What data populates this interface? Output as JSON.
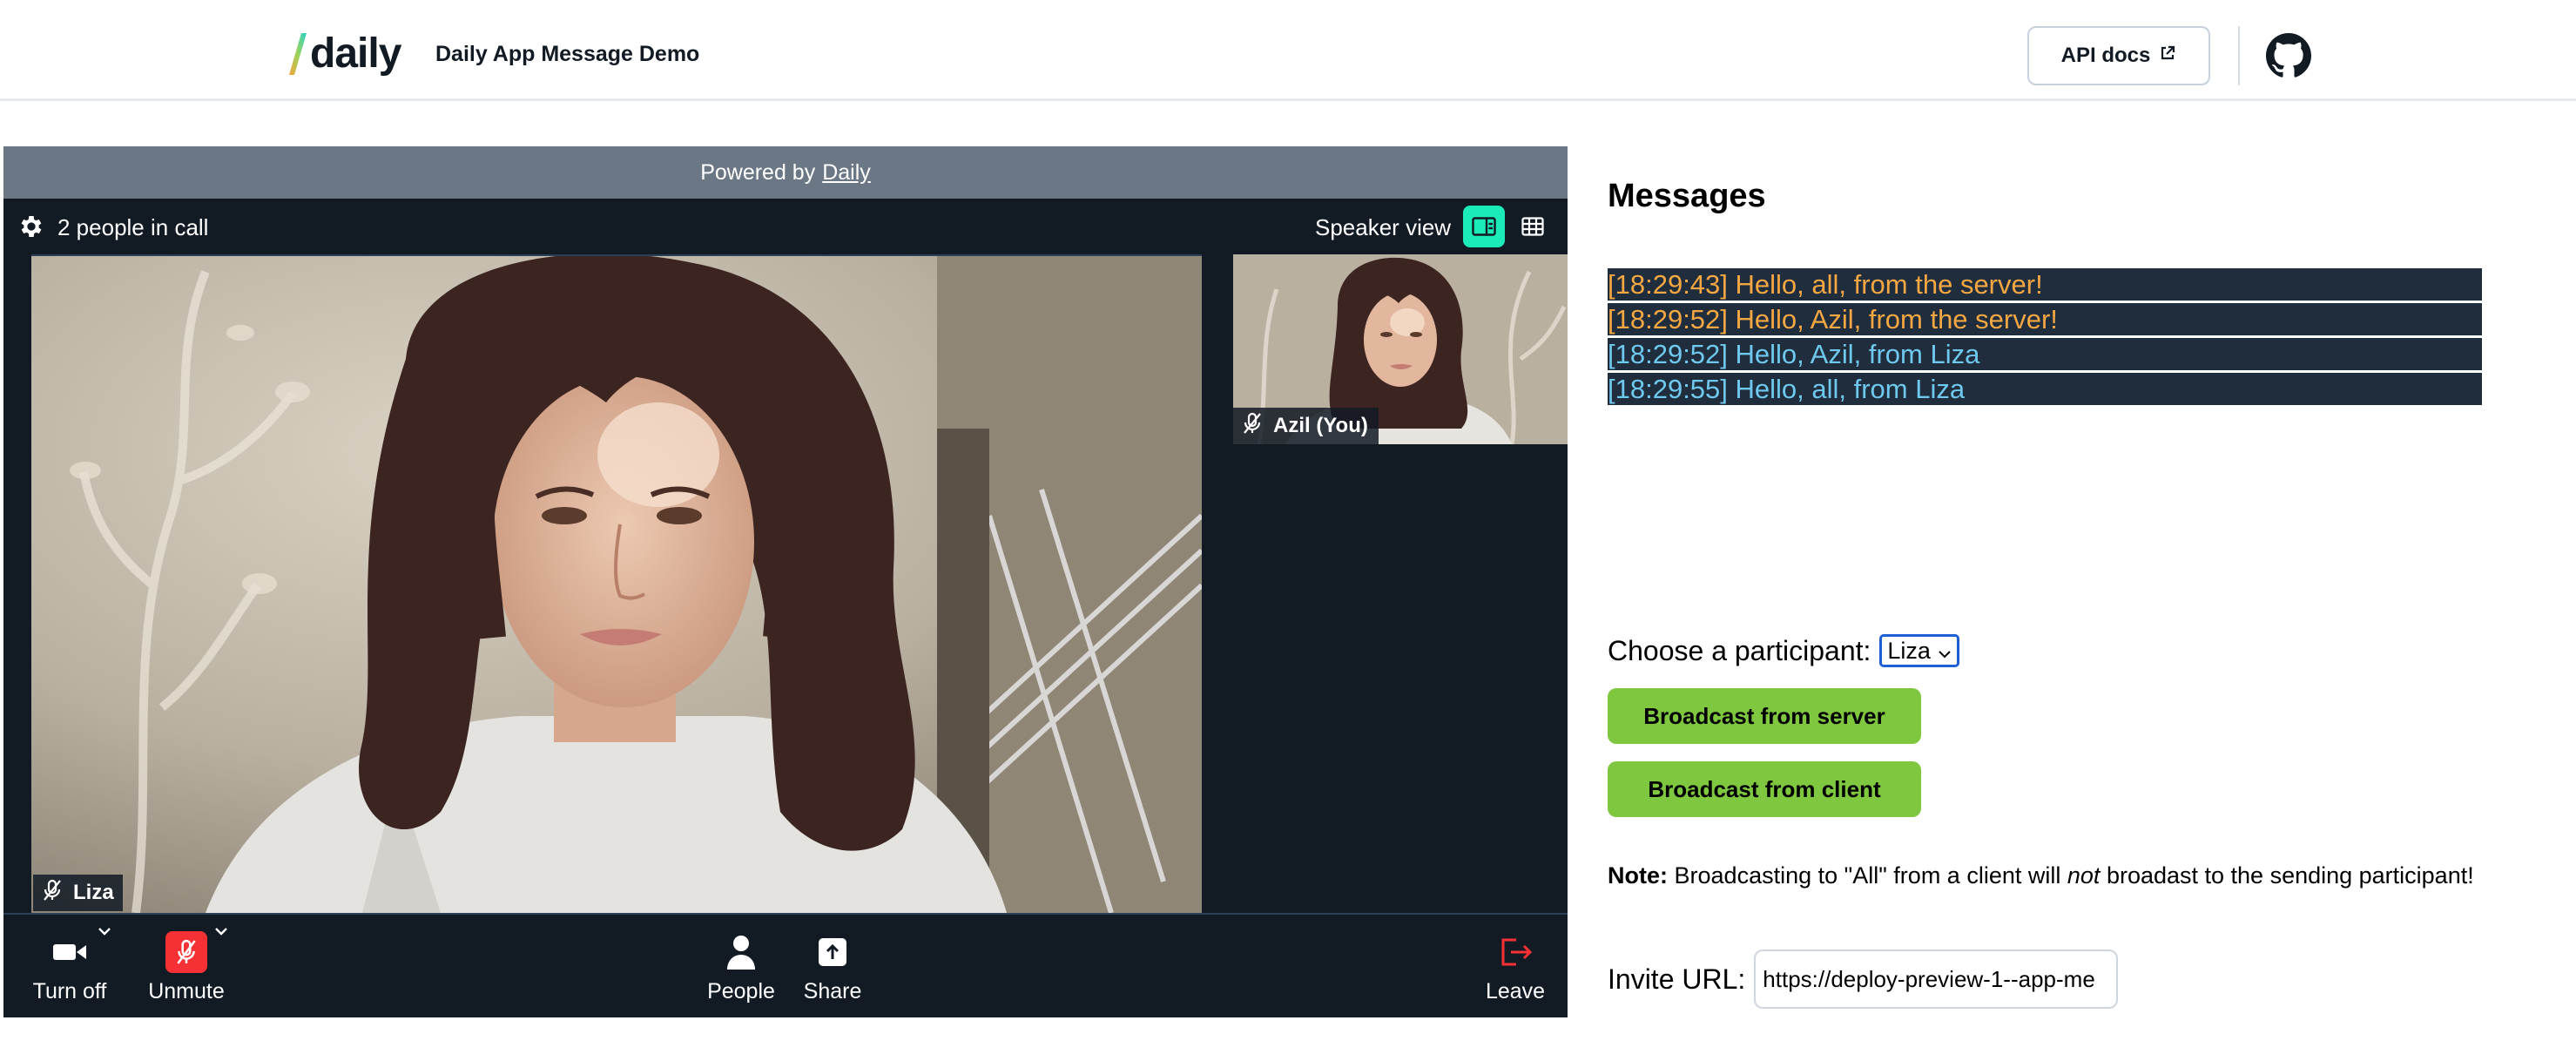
{
  "header": {
    "logo_text": "daily",
    "app_title": "Daily App Message Demo",
    "api_docs_label": "API docs"
  },
  "call": {
    "powered_by_prefix": "Powered by",
    "powered_by_link": "Daily",
    "people_count": "2 people in call",
    "view_label": "Speaker view",
    "main_participant": "Liza",
    "thumb_participant": "Azil (You)",
    "tray": {
      "camera": "Turn off",
      "mic": "Unmute",
      "people": "People",
      "share": "Share",
      "leave": "Leave"
    }
  },
  "messages": {
    "title": "Messages",
    "items": [
      {
        "text": "[18:29:43] Hello, all, from the server!",
        "kind": "server"
      },
      {
        "text": "[18:29:52] Hello, Azil, from the server!",
        "kind": "server"
      },
      {
        "text": "[18:29:52] Hello, Azil, from Liza",
        "kind": "client"
      },
      {
        "text": "[18:29:55] Hello, all, from Liza",
        "kind": "client"
      }
    ]
  },
  "controls": {
    "choose_label": "Choose a participant:",
    "participant_selected": "Liza",
    "broadcast_server": "Broadcast from server",
    "broadcast_client": "Broadcast from client",
    "note_bold": "Note:",
    "note_text_1": "Broadcasting to \"All\" from a client will",
    "note_italic": "not",
    "note_text_2": "broadast to the sending participant!",
    "invite_label": "Invite URL:",
    "invite_value": "https://deploy-preview-1--app-me"
  },
  "colors": {
    "server_message": "#f4a742",
    "client_message": "#6fc8ee",
    "message_bg": "#1f2d3d",
    "button_green": "#7ec73e",
    "accent_teal": "#1bebb9",
    "mic_red": "#f63135",
    "call_bg": "#121a24"
  }
}
